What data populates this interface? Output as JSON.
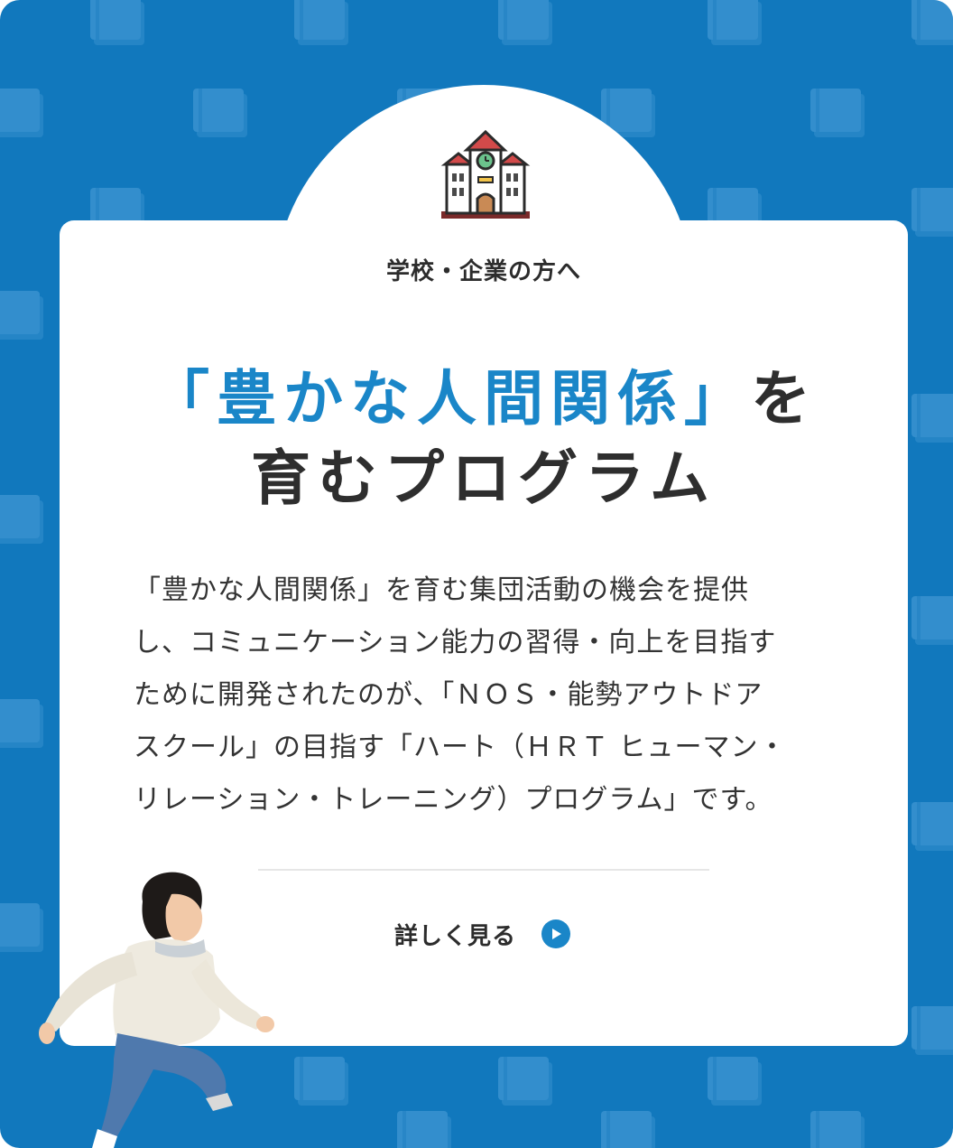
{
  "section": {
    "eyebrow": "学校・企業の方へ",
    "headline": {
      "line1_accent": "「豊かな人間関係」",
      "line1_rest": "を",
      "line2": "育むプログラム"
    },
    "description_lines": [
      "「豊かな人間関係」を育む集団活動の機会を提供",
      "し、コミュニケーション能力の習得・向上を目指す",
      "ために開発されたのが、「ＮＯＳ・能勢アウトドア",
      "スクール」の目指す「ハート（ＨＲＴ ヒューマン・",
      "リレーション・トレーニング）プログラム」です。"
    ],
    "more_link_label": "詳しく見る"
  },
  "icons": {
    "header": "school-building-icon",
    "link": "play-circle-icon",
    "background": "book-icon"
  },
  "colors": {
    "background": "#1178bd",
    "accent": "#1a86c8",
    "card": "#ffffff",
    "text": "#333333"
  }
}
